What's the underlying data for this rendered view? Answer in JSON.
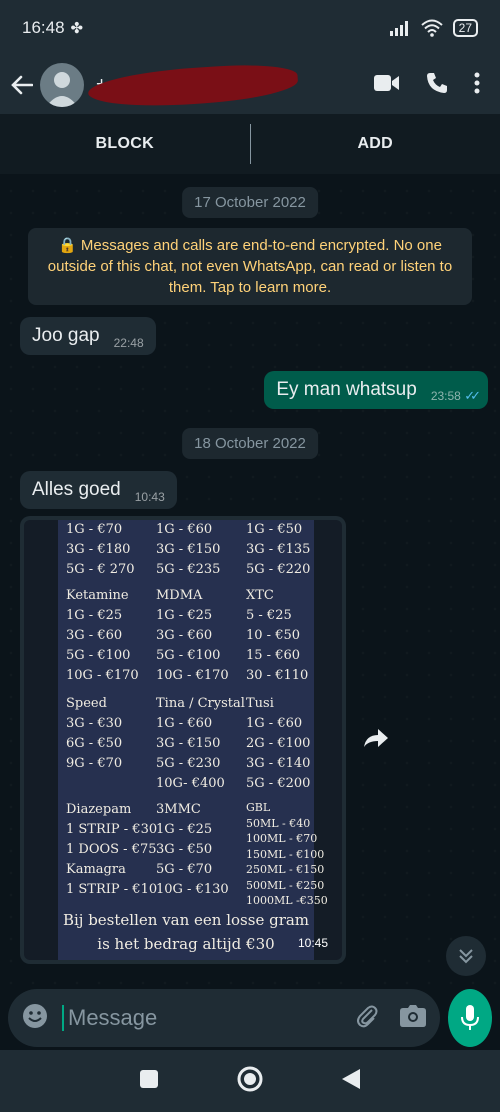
{
  "status_bar": {
    "time": "16:48",
    "battery": "27"
  },
  "header": {
    "contact_prefix": "+"
  },
  "banner": {
    "block_label": "BLOCK",
    "add_label": "ADD"
  },
  "dates": {
    "first": "17 October 2022",
    "second": "18 October 2022"
  },
  "encryption_notice": "🔒 Messages and calls are end-to-end encrypted. No one outside of this chat, not even WhatsApp, can read or listen to them. Tap to learn more.",
  "messages": [
    {
      "text": "Joo gap",
      "time": "22:48",
      "direction": "incoming"
    },
    {
      "text": "Ey man whatsup",
      "time": "23:58",
      "direction": "outgoing"
    },
    {
      "text": "Alles goed",
      "time": "10:43",
      "direction": "incoming"
    }
  ],
  "image_message": {
    "time": "10:45",
    "menu": {
      "col1_top": "1G - €70\n3G - €180\n5G - € 270",
      "col2_top": "1G - €60\n3G - €150\n5G - €235",
      "col3_top": "1G - €50\n3G - €135\n5G - €220",
      "ketamine": "Ketamine\n1G - €25\n3G - €60\n5G - €100\n10G - €170",
      "mdma": "MDMA\n1G - €25\n3G - €60\n5G - €100\n10G - €170",
      "xtc": "XTC\n5 - €25\n10 - €50\n15 - €60\n30 - €110",
      "speed": "Speed\n3G - €30\n6G - €50\n9G - €70",
      "tina": "Tina / Crystal\n1G - €60\n3G - €150\n5G - €230\n10G- €400",
      "tusi": "Tusi\n1G - €60\n2G - €100\n3G - €140\n5G - €200",
      "diazepam": "Diazepam\n1 STRIP - €30\n1 DOOS - €75\nKamagra\n1 STRIP - €10",
      "mmc": "3MMC\n1G - €25\n3G - €50\n5G - €70\n10G - €130",
      "gbl": "GBL\n50ML - €40\n100ML - €70\n150ML - €100\n250ML - €150\n500ML - €250\n1000ML -€350",
      "footer": "Bij bestellen van een losse gram is het bedrag altijd €30"
    }
  },
  "composer": {
    "placeholder": "Message"
  },
  "icons": {
    "back": "back-arrow-icon",
    "video": "video-call-icon",
    "call": "phone-icon",
    "menu": "more-vert-icon",
    "emoji": "emoji-icon",
    "attach": "paperclip-icon",
    "camera": "camera-icon",
    "mic": "mic-icon",
    "forward": "forward-icon",
    "scroll": "chevron-double-down-icon"
  },
  "colors": {
    "accent": "#00a884",
    "outgoing_bubble": "#005c4b",
    "incoming_bubble": "#1f2c34",
    "background": "#0b141a",
    "notice_text": "#ffd279"
  }
}
